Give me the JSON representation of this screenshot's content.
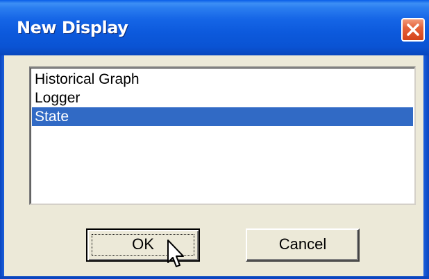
{
  "dialog": {
    "title": "New Display",
    "close_icon": "close-x-icon"
  },
  "list": {
    "items": [
      {
        "label": "Historical Graph",
        "selected": false
      },
      {
        "label": "Logger",
        "selected": false
      },
      {
        "label": "State",
        "selected": true
      }
    ]
  },
  "buttons": {
    "ok_label": "OK",
    "cancel_label": "Cancel"
  },
  "cursor": {
    "icon": "mouse-pointer-icon"
  },
  "colors": {
    "titlebar": "#0a53d3",
    "selection": "#316ac5",
    "face": "#ece9d8",
    "close": "#e5623a"
  }
}
